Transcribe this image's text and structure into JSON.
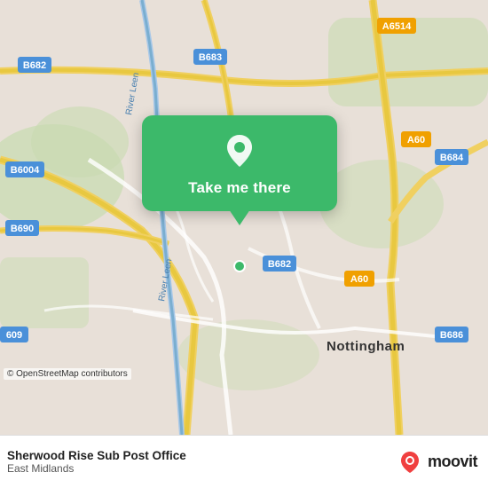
{
  "map": {
    "center_city": "Nottingham",
    "roads": {
      "b682": "B682",
      "b683": "B683",
      "b684": "B684",
      "a6514": "A6514",
      "a60": "A60",
      "b6004": "B6004",
      "b690": "B690",
      "b686": "B686",
      "b609": "609"
    },
    "rivers": [
      "River Leen",
      "River Leen"
    ]
  },
  "popup": {
    "button_label": "Take me there",
    "pin_color": "#ffffff"
  },
  "footer": {
    "location": "Sherwood Rise Sub Post Office",
    "region": "East Midlands",
    "osm_credit": "© OpenStreetMap contributors",
    "moovit_label": "moovit"
  }
}
